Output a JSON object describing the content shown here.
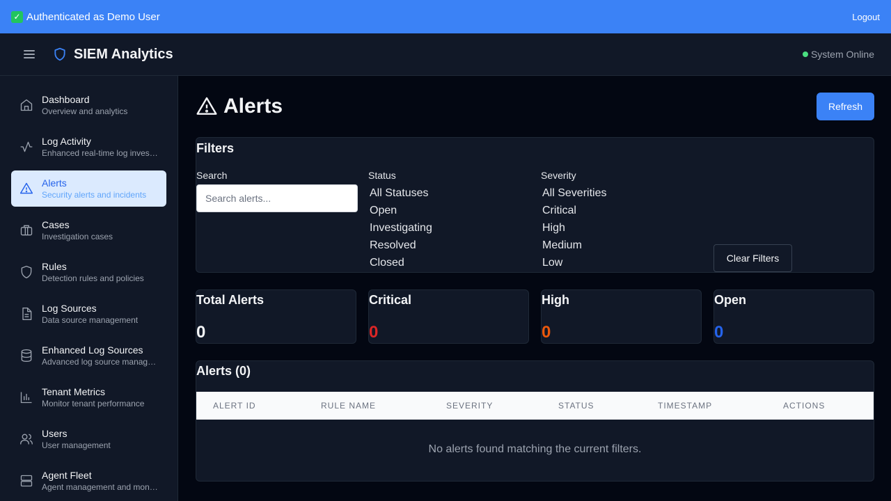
{
  "topbar": {
    "auth_text": "Authenticated as Demo User",
    "logout_label": "Logout",
    "accent": "#3b82f6"
  },
  "header": {
    "app_title": "SIEM Analytics",
    "status_text": "System Online"
  },
  "sidebar": {
    "items": [
      {
        "label": "Dashboard",
        "sub": "Overview and analytics",
        "icon": "home-icon"
      },
      {
        "label": "Log Activity",
        "sub": "Enhanced real-time log investigation",
        "icon": "activity-icon"
      },
      {
        "label": "Alerts",
        "sub": "Security alerts and incidents",
        "icon": "alert-triangle-icon",
        "active": true
      },
      {
        "label": "Cases",
        "sub": "Investigation cases",
        "icon": "briefcase-icon"
      },
      {
        "label": "Rules",
        "sub": "Detection rules and policies",
        "icon": "shield-icon"
      },
      {
        "label": "Log Sources",
        "sub": "Data source management",
        "icon": "file-text-icon"
      },
      {
        "label": "Enhanced Log Sources",
        "sub": "Advanced log source management",
        "icon": "database-icon"
      },
      {
        "label": "Tenant Metrics",
        "sub": "Monitor tenant performance",
        "icon": "bar-chart-icon"
      },
      {
        "label": "Users",
        "sub": "User management",
        "icon": "users-icon"
      },
      {
        "label": "Agent Fleet",
        "sub": "Agent management and monitoring",
        "icon": "server-icon"
      }
    ]
  },
  "main": {
    "page_title": "Alerts",
    "refresh_label": "Refresh",
    "filters": {
      "title": "Filters",
      "search_label": "Search",
      "search_placeholder": "Search alerts...",
      "status_label": "Status",
      "status_options": [
        "All Statuses",
        "Open",
        "Investigating",
        "Resolved",
        "Closed"
      ],
      "severity_label": "Severity",
      "severity_options": [
        "All Severities",
        "Critical",
        "High",
        "Medium",
        "Low"
      ],
      "clear_label": "Clear Filters"
    },
    "stats": [
      {
        "label": "Total Alerts",
        "value": "0",
        "color": "#f3f4f6"
      },
      {
        "label": "Critical",
        "value": "0",
        "color": "#dc2626"
      },
      {
        "label": "High",
        "value": "0",
        "color": "#ea580c"
      },
      {
        "label": "Open",
        "value": "0",
        "color": "#2563eb"
      }
    ],
    "table": {
      "title": "Alerts (0)",
      "columns": [
        "ALERT ID",
        "RULE NAME",
        "SEVERITY",
        "STATUS",
        "TIMESTAMP",
        "ACTIONS"
      ],
      "empty_text": "No alerts found matching the current filters."
    }
  }
}
